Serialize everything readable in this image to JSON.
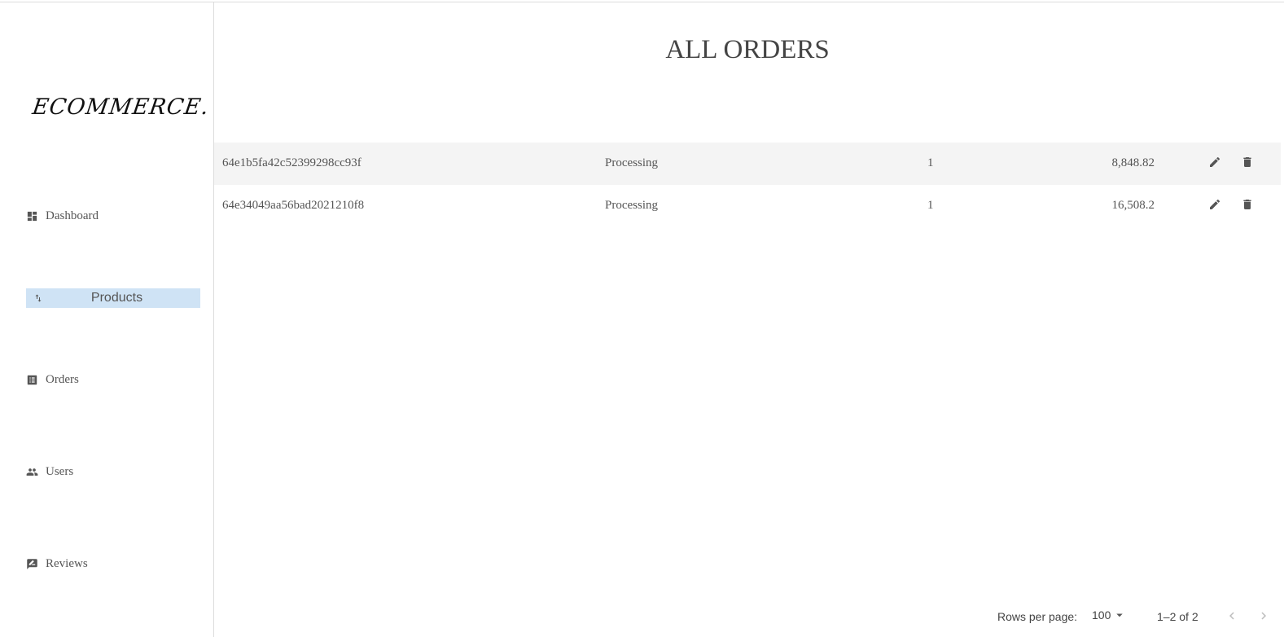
{
  "brand": {
    "logo_text": "ECOMMERCE."
  },
  "sidebar": {
    "items": [
      {
        "label": "Dashboard",
        "icon": "dashboard-icon"
      },
      {
        "label": "Products",
        "icon": "import-export-icon"
      },
      {
        "label": "Orders",
        "icon": "list-alt-icon"
      },
      {
        "label": "Users",
        "icon": "people-icon"
      },
      {
        "label": "Reviews",
        "icon": "rate-review-icon"
      }
    ]
  },
  "main": {
    "title": "ALL ORDERS",
    "rows": [
      {
        "id": "64e1b5fa42c52399298cc93f",
        "status": "Processing",
        "qty": "1",
        "amount": "8,848.82"
      },
      {
        "id": "64e34049aa56bad2021210f8",
        "status": "Processing",
        "qty": "1",
        "amount": "16,508.2"
      }
    ]
  },
  "pagination": {
    "rows_per_page_label": "Rows per page:",
    "rows_per_page_value": "100",
    "range_text": "1–2 of 2"
  },
  "colors": {
    "selected_nav_bg": "#cfe3f5",
    "row_highlight": "#f4f4f4",
    "text": "#555555"
  }
}
